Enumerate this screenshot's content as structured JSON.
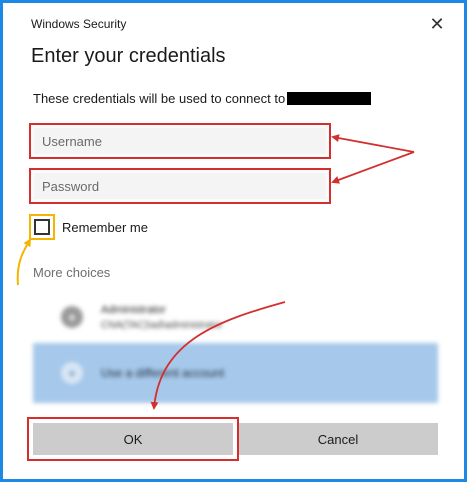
{
  "window": {
    "title": "Windows Security",
    "close_glyph": "✕"
  },
  "dialog": {
    "heading": "Enter your credentials",
    "subtitle": "These credentials will be used to connect to"
  },
  "fields": {
    "username": {
      "placeholder": "Username",
      "value": ""
    },
    "password": {
      "placeholder": "Password",
      "value": ""
    }
  },
  "remember": {
    "label": "Remember me",
    "checked": false
  },
  "more_choices": {
    "label": "More choices"
  },
  "accounts": [
    {
      "name": "Administrator",
      "sub": "CNA(TAC)\\ad\\administrator",
      "icon": "user-icon"
    },
    {
      "name": "Use a different account",
      "icon": "user-icon"
    }
  ],
  "buttons": {
    "ok": "OK",
    "cancel": "Cancel"
  },
  "colors": {
    "frame_border": "#1e88e5",
    "annotation_red": "#d32f2f",
    "annotation_yellow": "#f5b400",
    "selected_account_bg": "#a6c8ea",
    "button_bg": "#cccccc"
  }
}
